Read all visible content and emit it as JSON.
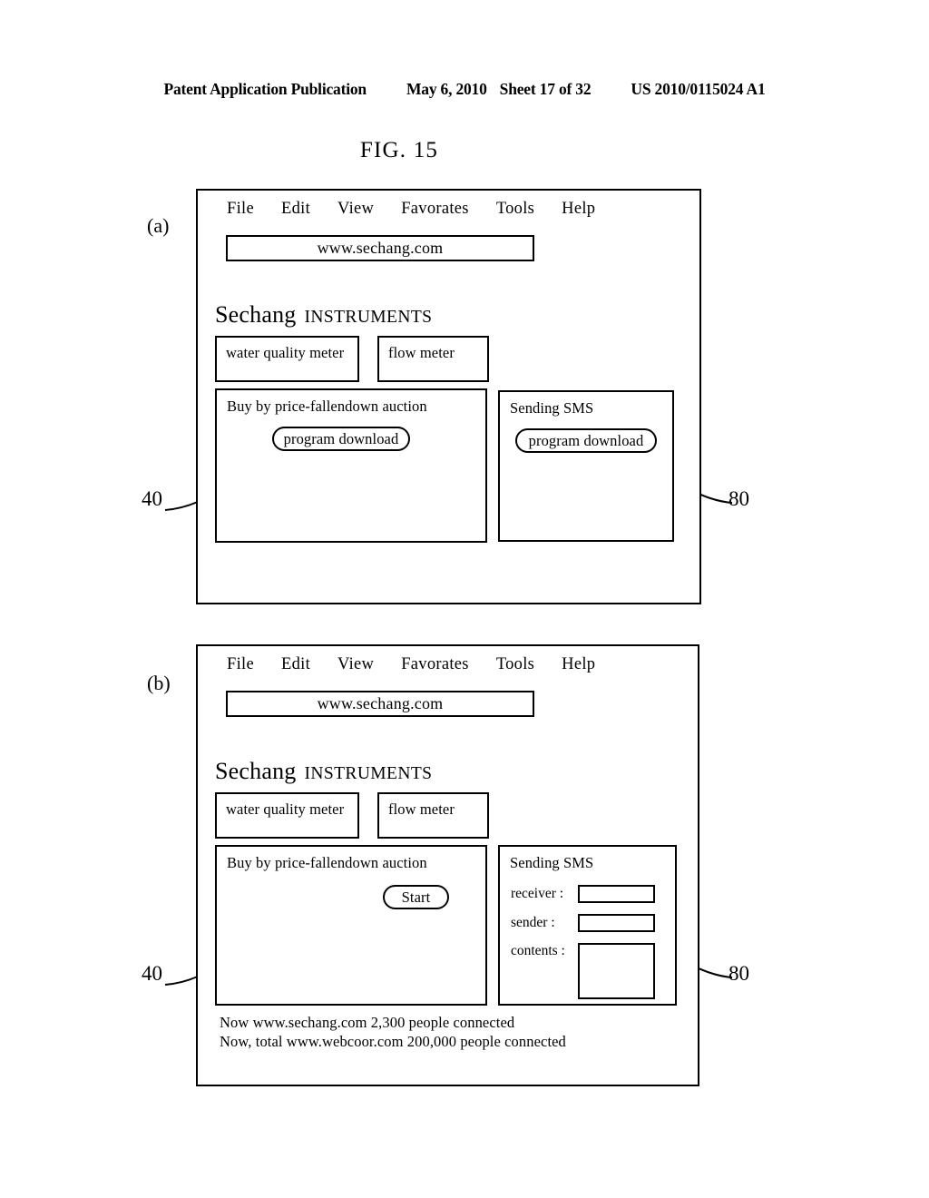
{
  "page_header": {
    "publication": "Patent Application Publication",
    "date": "May 6, 2010",
    "sheet": "Sheet 17 of 32",
    "patent_number": "US 2010/0115024 A1"
  },
  "figure": {
    "title": "FIG. 15",
    "panel_a_label": "(a)",
    "panel_b_label": "(b)"
  },
  "reference_numerals": {
    "left": "40",
    "right": "80"
  },
  "browser": {
    "menu_items": [
      "File",
      "Edit",
      "View",
      "Favorates",
      "Tools",
      "Help"
    ],
    "address": "www.sechang.com",
    "brand_main": "Sechang",
    "brand_sub": "INSTRUMENTS",
    "product_buttons": [
      "water quality meter",
      "flow meter"
    ]
  },
  "panel_a": {
    "auction": {
      "title": "Buy by price-fallendown auction",
      "button": "program download"
    },
    "sms": {
      "title": "Sending SMS",
      "button": "program download"
    }
  },
  "panel_b": {
    "auction": {
      "title": "Buy by price-fallendown auction",
      "button": "Start"
    },
    "sms": {
      "title": "Sending SMS",
      "fields": [
        {
          "label": "receiver :",
          "value": ""
        },
        {
          "label": "sender   :",
          "value": ""
        },
        {
          "label": "contents :",
          "value": ""
        }
      ]
    },
    "status": {
      "line1": "Now  www.sechang.com  2,300 people connected",
      "line2": "Now, total  www.webcoor.com  200,000 people connected"
    }
  }
}
